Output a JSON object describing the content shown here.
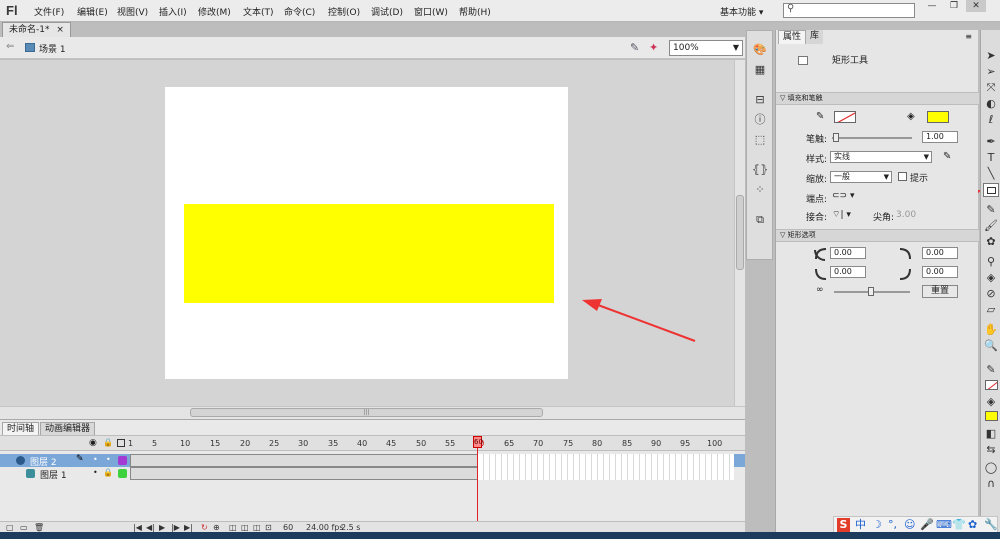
{
  "app": {
    "logo": "Fl"
  },
  "menu": [
    "文件(F)",
    "编辑(E)",
    "视图(V)",
    "插入(I)",
    "修改(M)",
    "文本(T)",
    "命令(C)",
    "控制(O)",
    "调试(D)",
    "窗口(W)",
    "帮助(H)"
  ],
  "workspace": "基本功能",
  "search": {
    "placeholder": ""
  },
  "window_controls": {
    "minimize": "—",
    "restore": "❐",
    "close": "✕"
  },
  "document_tab": {
    "label": "未命名-1*",
    "close": "×"
  },
  "editbar": {
    "scene": "场景 1",
    "zoom": "100%"
  },
  "stage": {
    "background": "#ffffff",
    "rect_fill": "#ffff00"
  },
  "timeline": {
    "tabs": [
      "时间轴",
      "动画编辑器"
    ],
    "ruler": [
      "1",
      "5",
      "10",
      "15",
      "20",
      "25",
      "30",
      "35",
      "40",
      "45",
      "50",
      "55",
      "60",
      "65",
      "70",
      "75",
      "80",
      "85",
      "90",
      "95",
      "100"
    ],
    "layers": [
      {
        "name": "图层 2",
        "selected": true,
        "color": "#a33ad4"
      },
      {
        "name": "图层 1",
        "selected": false,
        "color": "#3fd23f"
      }
    ],
    "playhead_frame": "60",
    "status": {
      "frame": "60",
      "fps": "24.00 fps",
      "time": "2.5 s"
    }
  },
  "properties": {
    "tabs": [
      "属性",
      "库"
    ],
    "tool_name": "矩形工具",
    "sections": {
      "fill_stroke": "填充和笔触",
      "rect_options": "矩形选项"
    },
    "stroke_label": "笔触:",
    "stroke_value": "1.00",
    "style_label": "样式:",
    "style_value": "实线",
    "scale_label": "缩放:",
    "scale_value": "一般",
    "hint_label": "提示",
    "cap_label": "端点:",
    "join_label": "接合:",
    "miter_label": "尖角:",
    "miter_value": "3.00",
    "corners": [
      "0.00",
      "0.00",
      "0.00",
      "0.00"
    ],
    "reset_label": "重置",
    "fill_color": "#ffff00"
  },
  "tray": {
    "ime": "中",
    "icons": [
      "S",
      "中",
      "☽",
      "°,",
      "☺",
      "🎤",
      "⌨",
      "👕",
      "✿",
      "🔧"
    ]
  }
}
